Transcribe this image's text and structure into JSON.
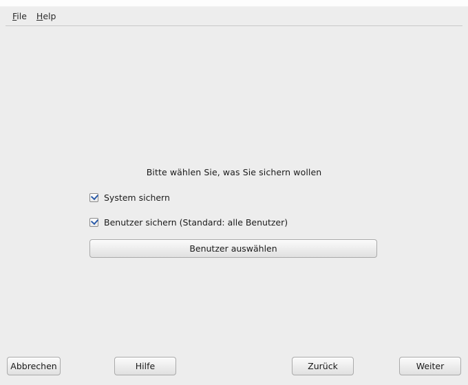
{
  "menubar": {
    "file": {
      "label_rest": "ile",
      "mnemonic": "F"
    },
    "help": {
      "label_rest": "elp",
      "mnemonic": "H"
    }
  },
  "content": {
    "prompt": "Bitte wählen Sie, was Sie sichern wollen",
    "options": {
      "backup_system": {
        "label": "System sichern",
        "checked": true
      },
      "backup_users": {
        "label": "Benutzer sichern (Standard: alle Benutzer)",
        "checked": true
      }
    },
    "select_users_button": "Benutzer auswählen"
  },
  "footer": {
    "cancel": "Abbrechen",
    "help": "Hilfe",
    "back": "Zurück",
    "next": "Weiter"
  }
}
